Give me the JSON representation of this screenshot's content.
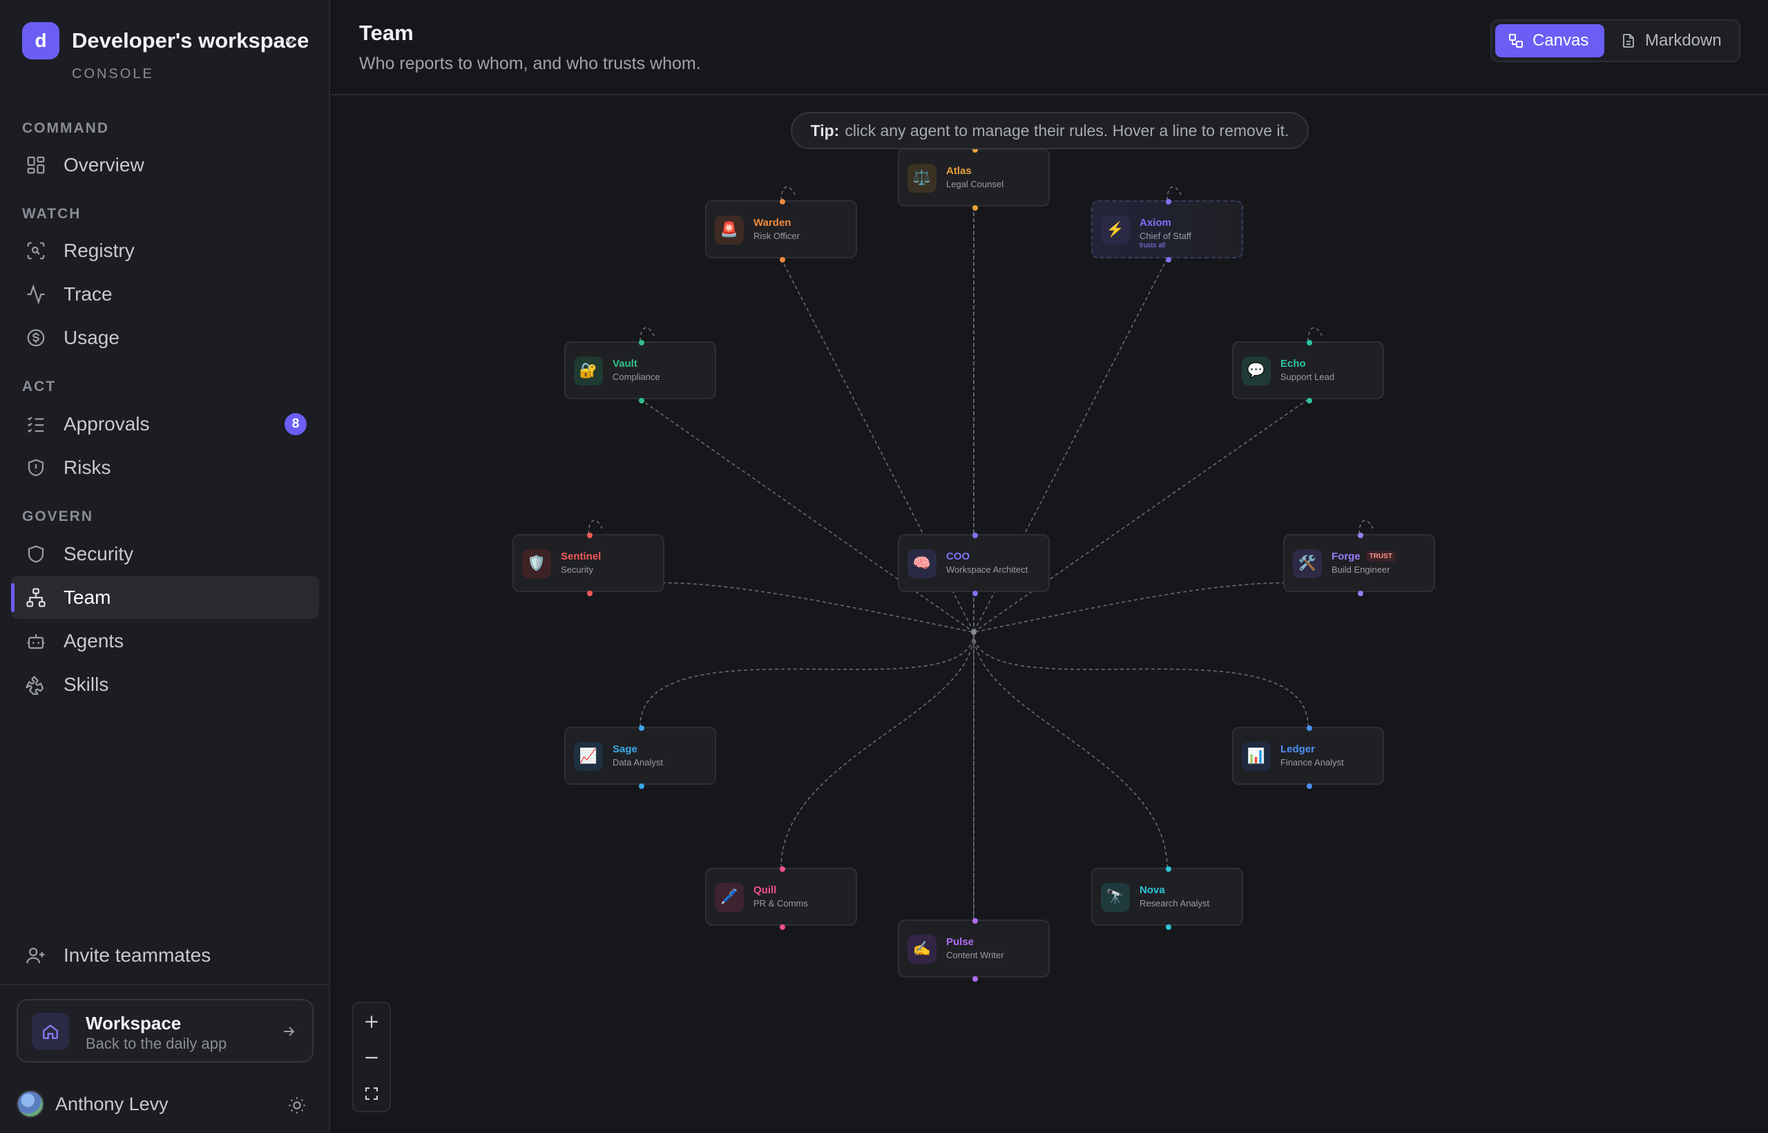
{
  "workspace": {
    "initial": "d",
    "name": "Developer's workspace",
    "console_label": "CONSOLE"
  },
  "nav": {
    "sections": [
      {
        "label": "COMMAND",
        "items": [
          {
            "label": "Overview",
            "icon": "grid-icon"
          }
        ]
      },
      {
        "label": "WATCH",
        "items": [
          {
            "label": "Registry",
            "icon": "scan-icon"
          },
          {
            "label": "Trace",
            "icon": "activity-icon"
          },
          {
            "label": "Usage",
            "icon": "dollar-icon"
          }
        ]
      },
      {
        "label": "ACT",
        "items": [
          {
            "label": "Approvals",
            "icon": "checklist-icon",
            "badge": "8"
          },
          {
            "label": "Risks",
            "icon": "shield-alert-icon"
          }
        ]
      },
      {
        "label": "GOVERN",
        "items": [
          {
            "label": "Security",
            "icon": "shield-icon"
          },
          {
            "label": "Team",
            "icon": "org-chart-icon",
            "active": true
          },
          {
            "label": "Agents",
            "icon": "bot-icon"
          },
          {
            "label": "Skills",
            "icon": "puzzle-icon"
          }
        ]
      }
    ],
    "invite": "Invite teammates"
  },
  "workspace_card": {
    "title": "Workspace",
    "subtitle": "Back to the daily app"
  },
  "user": {
    "name": "Anthony Levy"
  },
  "header": {
    "title": "Team",
    "subtitle": "Who reports to whom, and who trusts whom."
  },
  "view_toggle": {
    "canvas": "Canvas",
    "markdown": "Markdown",
    "selected": "Canvas"
  },
  "tip": {
    "bold": "Tip:",
    "text": "click any agent to manage their rules. Hover a line to remove it."
  },
  "colors": {
    "accent": "#6b5ef5",
    "edge": "#6a6c74"
  },
  "agents": [
    {
      "id": "atlas",
      "name": "Atlas",
      "role": "Legal Counsel",
      "emoji": "⚖️",
      "color": "#e8a13a",
      "icon_bg": "#3a3122"
    },
    {
      "id": "warden",
      "name": "Warden",
      "role": "Risk Officer",
      "emoji": "🚨",
      "color": "#f08a3c",
      "icon_bg": "#3d2a22"
    },
    {
      "id": "axiom",
      "name": "Axiom",
      "role": "Chief of Staff",
      "emoji": "⚡",
      "color": "#7d74f7",
      "icon_bg": "#2b2a45",
      "tag": "trusts all"
    },
    {
      "id": "vault",
      "name": "Vault",
      "role": "Compliance",
      "emoji": "🔐",
      "color": "#33c08a",
      "icon_bg": "#1f3a30"
    },
    {
      "id": "echo",
      "name": "Echo",
      "role": "Support Lead",
      "emoji": "💬",
      "color": "#2ec4a0",
      "icon_bg": "#1f3a35"
    },
    {
      "id": "sentinel",
      "name": "Sentinel",
      "role": "Security",
      "emoji": "🛡️",
      "color": "#f05a5a",
      "icon_bg": "#3d2226"
    },
    {
      "id": "coo",
      "name": "COO",
      "role": "Workspace Architect",
      "emoji": "🧠",
      "color": "#7d74f7",
      "icon_bg": "#2b2a45"
    },
    {
      "id": "forge",
      "name": "Forge",
      "role": "Build Engineer",
      "emoji": "🛠️",
      "color": "#9a7cf7",
      "icon_bg": "#2e2a45",
      "badge": "TRUST"
    },
    {
      "id": "sage",
      "name": "Sage",
      "role": "Data Analyst",
      "emoji": "📈",
      "color": "#3aa8e8",
      "icon_bg": "#1f3040"
    },
    {
      "id": "ledger",
      "name": "Ledger",
      "role": "Finance Analyst",
      "emoji": "📊",
      "color": "#4a8ff0",
      "icon_bg": "#1f2a40"
    },
    {
      "id": "quill",
      "name": "Quill",
      "role": "PR & Comms",
      "emoji": "🖊️",
      "color": "#f0508a",
      "icon_bg": "#3d2230"
    },
    {
      "id": "nova",
      "name": "Nova",
      "role": "Research Analyst",
      "emoji": "🔭",
      "color": "#2ec4d8",
      "icon_bg": "#1f3a3d"
    },
    {
      "id": "pulse",
      "name": "Pulse",
      "role": "Content Writer",
      "emoji": "✍️",
      "color": "#b06ef5",
      "icon_bg": "#322545"
    }
  ]
}
